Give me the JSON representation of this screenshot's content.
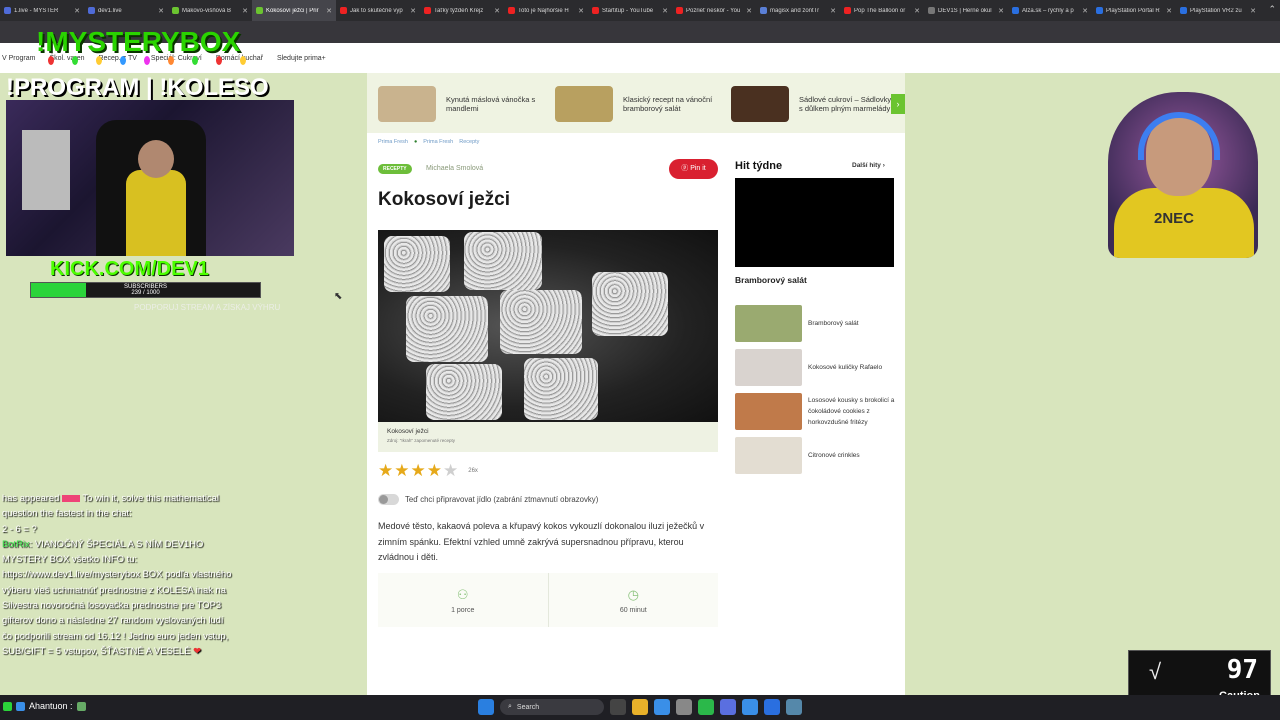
{
  "browser": {
    "tabs": [
      {
        "title": "1.live - MYSTER",
        "color": "#4f6bd8"
      },
      {
        "title": "dev1.live",
        "color": "#4f6bd8"
      },
      {
        "title": "Makovo-višňová B",
        "color": "#6bc430"
      },
      {
        "title": "Kokosoví ježci | Prir",
        "color": "#6bc430",
        "active": true
      },
      {
        "title": "Jak to skutečně vyp",
        "color": "#e22"
      },
      {
        "title": "Taťký týždeň Krejz",
        "color": "#e22"
      },
      {
        "title": "Toto je Najhoršie H",
        "color": "#e22"
      },
      {
        "title": "Startitup - YouTube",
        "color": "#e22"
      },
      {
        "title": "Pozrieť neskôr - You",
        "color": "#e22"
      },
      {
        "title": "magisx and zontTr",
        "color": "#5a7fd6"
      },
      {
        "title": "Pop The Balloon or",
        "color": "#e22"
      },
      {
        "title": "DEV1S | Herné okul",
        "color": "#777"
      },
      {
        "title": "Alza.sk – rýchly a p",
        "color": "#2a6fe0"
      },
      {
        "title": "PlayStation Portal R",
        "color": "#2a6fe0"
      },
      {
        "title": "PlayStation VR2 zu",
        "color": "#2a6fe0"
      }
    ],
    "more": "⌃"
  },
  "site_nav": [
    "V Program",
    "Škol. varen",
    "Recep. z TV",
    "Speciál: Cukroví",
    "Domácí kuchař",
    "Sledujte prima+"
  ],
  "overlay": {
    "title1": "!MYSTERYBOX",
    "title2": "!PROGRAM | !KOLESO",
    "kick": "KICK.COM/DEV1",
    "subs_label": "SUBSCRIBERS",
    "subs_count": "239 / 1000",
    "subs_progress": 0.239,
    "note": "PODPORUJ STREAM A ZÍSKAJ VÝHRU",
    "light_colors": [
      "#e33",
      "#3d3",
      "#fc3",
      "#39f",
      "#e3e",
      "#f83",
      "#3d3",
      "#e33",
      "#fc3"
    ]
  },
  "chat": {
    "line1_a": "has appeared",
    "line1_b": "To win it, solve this mathematical question the fastest in the chat:",
    "line1_c": "2 - 6 = ?",
    "user": "BotRix",
    "message": ": VIANOČNÝ ŠPECIÁL A S NÍM DEV1HO MYSTERY BOX všetko INFO tu: https://www.dev1.live/mysterybox BOX podľa vlastného výberu vieš uchmatnúť prednostne z KOLESA inak na Silvestra novoročná losovačka prednostne pre TOP3 gifterov dono a následne 27 random vyslovaných ludí čo podporili stream od 16.12 ! Jedno euro jeden vstup, SUB/GIFT = 5 vstupov, ŠŤASTNÉ A VESELÉ",
    "heart": "❤"
  },
  "page": {
    "carousel": [
      {
        "text": "Kynutá máslová vánočka s mandlemi",
        "color": "#c9b38e"
      },
      {
        "text": "Klasický recept na vánoční bramborový salát",
        "color": "#b8a060"
      },
      {
        "text": "Sádlové cukroví – Sádlovky s důlkem plným marmelády",
        "color": "#4a3020"
      }
    ],
    "carousel_arrow": "›",
    "breadcrumbs": [
      "Prima Fresh",
      "Prima Fresh",
      "Recepty"
    ],
    "crumb_sep": "●",
    "tag": "RECEPTY",
    "author": "Michaela Smolová",
    "pin": "Pin it",
    "title": "Kokosoví ježci",
    "caption_title": "Kokosoví ježci",
    "caption_source": "Zdroj: \"Ikrah\" zapomenuté recepty",
    "rating": 4,
    "rating_max": 5,
    "rating_count": "26x",
    "toggle_label": "Teď chci připravovat jídlo (zabrání ztmavnutí obrazovky)",
    "description": "Medové těsto, kakaová poleva a křupavý kokos vykouzlí dokonalou iluzi ježečků v zimním spánku. Efektní vzhled umně zakrývá supersnadnou přípravu, kterou zvládnou i děti.",
    "portions": "1 porce",
    "time": "60 minut",
    "portions_icon": "person-icon",
    "time_icon": "clock-icon"
  },
  "sidebar": {
    "title": "Hit týdne",
    "more": "Další hity ›",
    "video_title": "Bramborový salát",
    "items": [
      {
        "label": "Bramborový salát",
        "color": "#9aaa70"
      },
      {
        "label": "Kokosové kuličky Rafaelo",
        "color": "#d9d3cf"
      },
      {
        "label": "Lososové kousky s brokolicí a čokoládové cookies z horkovzdušné fritézy",
        "color": "#c07a4a"
      },
      {
        "label": "Citronové crinkles",
        "color": "#e3ddd2"
      }
    ]
  },
  "health": {
    "value": "97",
    "status": "Caution",
    "icon": "√"
  },
  "taskbar": {
    "user": "Ahantuon :",
    "search": "Search",
    "icons": [
      "#2a7fe0",
      "#444",
      "#e8b12a",
      "#3a8fe8",
      "#888",
      "#2bb84a",
      "#5a6fe0",
      "#3a8fe8",
      "#2a6fe0",
      "#58a"
    ]
  },
  "colors": {
    "page_bg": "#d8e5bd",
    "accent_green": "#6bc430",
    "pin_red": "#d92030"
  }
}
